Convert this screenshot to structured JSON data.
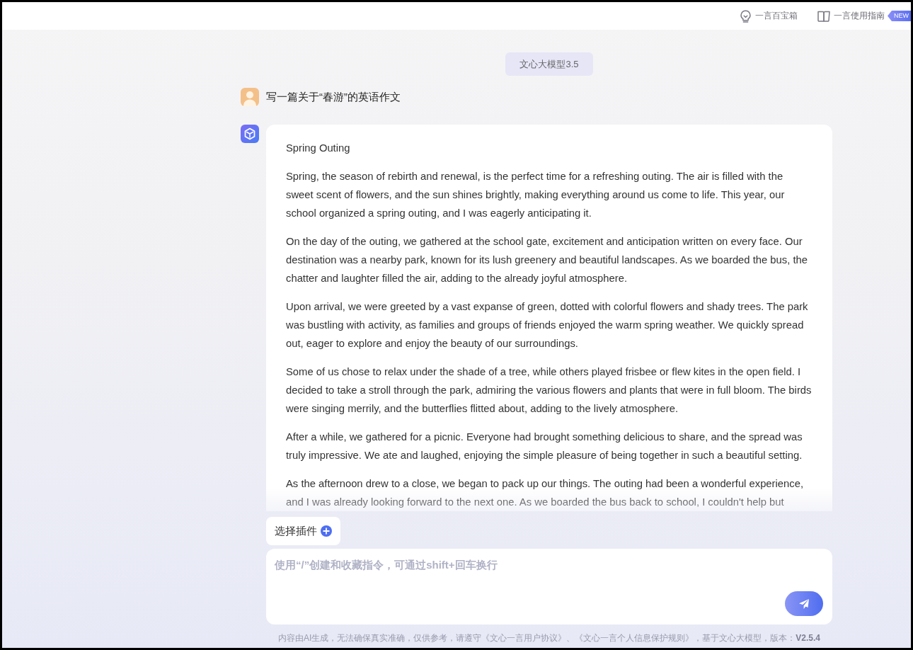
{
  "header": {
    "links": [
      {
        "kind": "toolbox",
        "label": "一言百宝箱"
      },
      {
        "kind": "guide",
        "label": "一言使用指南",
        "badge": "NEW"
      }
    ]
  },
  "chat": {
    "model_label": "文心大模型3.5",
    "messages": [
      {
        "kind": "prompt",
        "text": "写一篇关于“春游”的英语作文"
      },
      {
        "kind": "answer",
        "title": "Spring Outing",
        "paragraphs": [
          "Spring, the season of rebirth and renewal, is the perfect time for a refreshing outing. The air is filled with the sweet scent of flowers, and the sun shines brightly, making everything around us come to life. This year, our school organized a spring outing, and I was eagerly anticipating it.",
          "On the day of the outing, we gathered at the school gate, excitement and anticipation written on every face. Our destination was a nearby park, known for its lush greenery and beautiful landscapes. As we boarded the bus, the chatter and laughter filled the air, adding to the already joyful atmosphere.",
          "Upon arrival, we were greeted by a vast expanse of green, dotted with colorful flowers and shady trees. The park was bustling with activity, as families and groups of friends enjoyed the warm spring weather. We quickly spread out, eager to explore and enjoy the beauty of our surroundings.",
          "Some of us chose to relax under the shade of a tree, while others played frisbee or flew kites in the open field. I decided to take a stroll through the park, admiring the various flowers and plants that were in full bloom. The birds were singing merrily, and the butterflies flitted about, adding to the lively atmosphere.",
          "After a while, we gathered for a picnic. Everyone had brought something delicious to share, and the spread was truly impressive. We ate and laughed, enjoying the simple pleasure of being together in such a beautiful setting.",
          "As the afternoon drew to a close, we began to pack up our things. The outing had been a wonderful experience, and I was already looking forward to the next one. As we boarded the bus back to school, I couldn't help but"
        ]
      }
    ]
  },
  "composer": {
    "plugin_button": "选择插件",
    "placeholder": "使用“/”创建和收藏指令，可通过shift+回车换行"
  },
  "footer": {
    "notice": "内容由AI生成，无法确保真实准确，仅供参考，请遵守《文心一言用户协议》、《文心一言个人信息保护规则》，基于文心大模型，版本：**V2.5.4**"
  }
}
